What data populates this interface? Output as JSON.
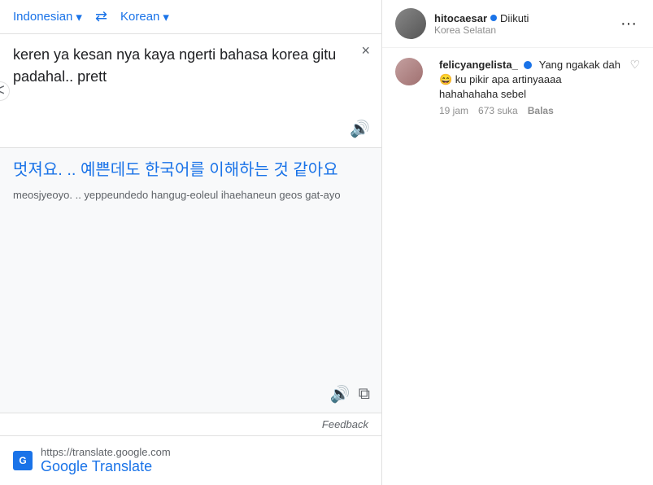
{
  "translate": {
    "source_lang": "Indonesian",
    "swap_label": "⇄",
    "target_lang": "Korean",
    "source_text": "keren ya kesan nya kaya ngerti bahasa korea gitu padahal.. prett",
    "clear_label": "×",
    "speaker_label": "🔊",
    "result_korean": "멋져요. .. 예쁜데도 한국어를 이해하는 것 같아요",
    "result_romanized": "meosjyeoyo. .. yeppeundedo hangug-eoleul ihaehaneun geos gat-ayo",
    "copy_label": "⧉",
    "feedback_label": "Feedback",
    "footer_url": "https://translate.google.com",
    "footer_name": "Google Translate"
  },
  "instagram": {
    "user": {
      "name": "hitocaesar",
      "verified": true,
      "followed": "Diikuti",
      "location": "Korea Selatan",
      "more": "···"
    },
    "comment": {
      "username": "felicyangelista_",
      "verified": true,
      "text": "Yang ngakak dah😄 ku pikir apa artinyaaaa hahahahaha sebel",
      "time": "19 jam",
      "likes": "673 suka",
      "reply": "Balas"
    }
  }
}
